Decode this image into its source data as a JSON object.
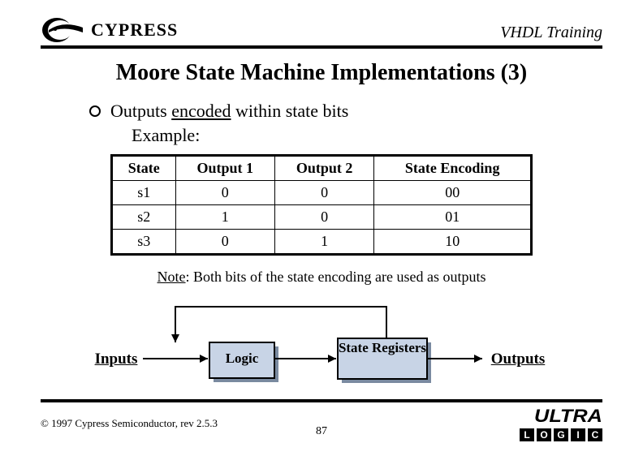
{
  "header": {
    "brand": "CYPRESS",
    "course": "VHDL Training"
  },
  "title": "Moore State Machine Implementations (3)",
  "bullet": {
    "pre": "Outputs ",
    "encoded": "encoded",
    "post": " within state bits"
  },
  "example_label": "Example:",
  "table": {
    "headers": [
      "State",
      "Output 1",
      "Output 2",
      "State Encoding"
    ],
    "rows": [
      [
        "s1",
        "0",
        "0",
        "00"
      ],
      [
        "s2",
        "1",
        "0",
        "01"
      ],
      [
        "s3",
        "0",
        "1",
        "10"
      ]
    ]
  },
  "note": {
    "label": "Note",
    "text": ": Both bits of the state encoding are used as outputs"
  },
  "diagram": {
    "inputs": "Inputs",
    "logic": "Logic",
    "state_registers": "State Registers",
    "outputs": "Outputs"
  },
  "footer": {
    "copyright": "© 1997 Cypress Semiconductor, rev 2.5.3",
    "page": "87",
    "ultra": "ULTRA",
    "logic_letters": [
      "L",
      "O",
      "G",
      "I",
      "C"
    ]
  }
}
